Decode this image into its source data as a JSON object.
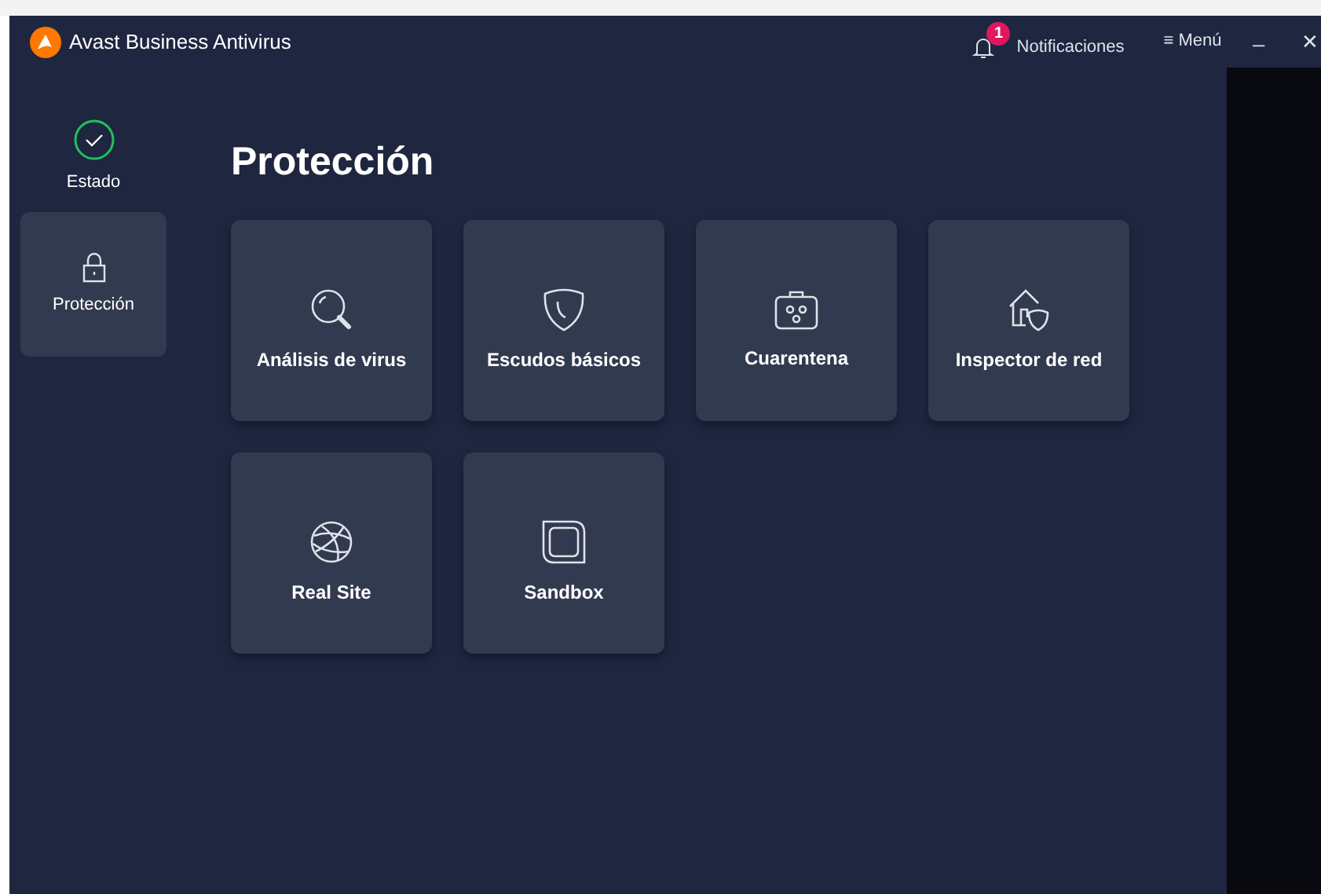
{
  "window": {
    "title": "Avast Business Antivirus"
  },
  "header": {
    "notifications": {
      "badge": "1",
      "label": "Notificaciones"
    },
    "menu": {
      "icon": "≡",
      "label": "Menú"
    },
    "minimize": "_",
    "close": "✕"
  },
  "sidebar": {
    "items": [
      {
        "kind": "status",
        "label": "Estado",
        "selected": false
      },
      {
        "kind": "lock",
        "label": "Protección",
        "selected": true
      }
    ]
  },
  "page": {
    "title": "Protección",
    "cards": [
      {
        "kind": "search",
        "label": "Análisis de virus"
      },
      {
        "kind": "shield",
        "label": "Escudos básicos"
      },
      {
        "kind": "quarantine",
        "label": "Cuarentena"
      },
      {
        "kind": "network",
        "label": "Inspector de red"
      },
      {
        "kind": "globe",
        "label": "Real Site"
      },
      {
        "kind": "sandbox",
        "label": "Sandbox"
      }
    ]
  }
}
